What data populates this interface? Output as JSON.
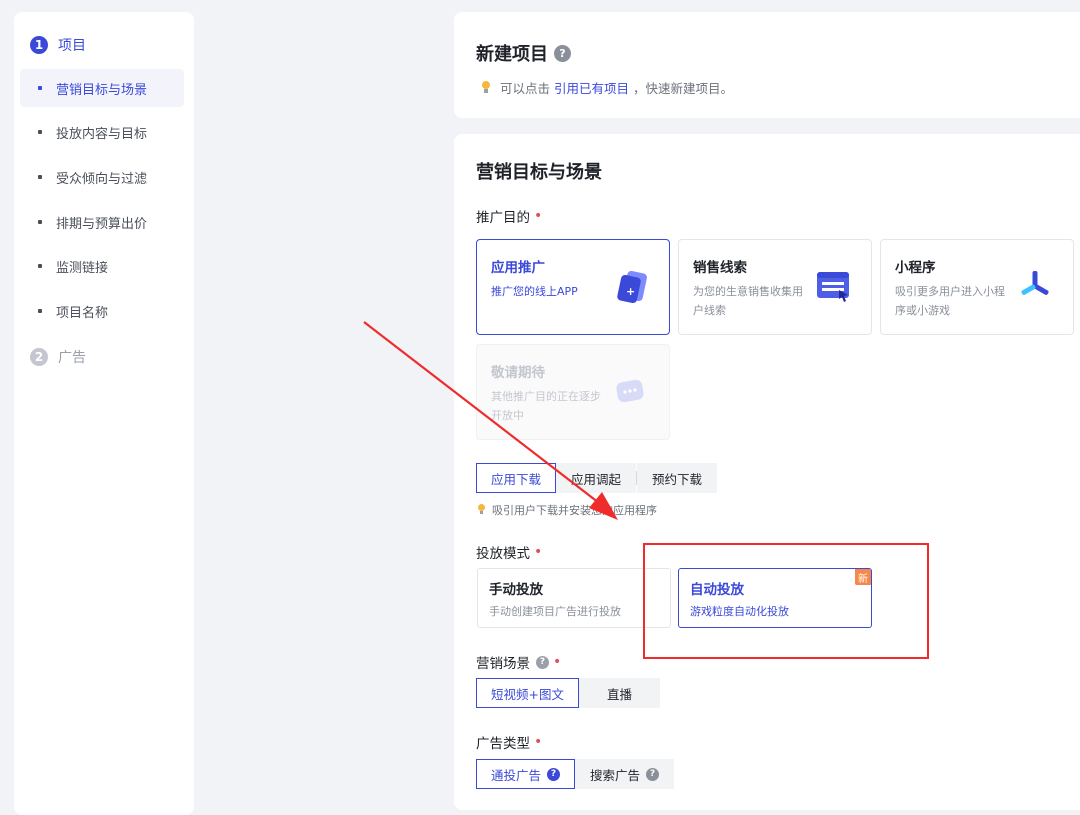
{
  "sidebar": {
    "steps": [
      {
        "num": "1",
        "label": "项目"
      },
      {
        "num": "2",
        "label": "广告"
      }
    ],
    "items": [
      {
        "label": "营销目标与场景"
      },
      {
        "label": "投放内容与目标"
      },
      {
        "label": "受众倾向与过滤"
      },
      {
        "label": "排期与预算出价"
      },
      {
        "label": "监测链接"
      },
      {
        "label": "项目名称"
      }
    ]
  },
  "header": {
    "title": "新建项目",
    "help_icon": "question-circle-icon",
    "hint_prefix": "可以点击",
    "hint_link": "引用已有项目",
    "hint_suffix": "，快速新建项目。"
  },
  "main": {
    "section_title": "营销目标与场景",
    "purpose": {
      "label": "推广目的",
      "required": "•",
      "cards": [
        {
          "title": "应用推广",
          "desc": "推广您的线上APP",
          "icon": "app-phone-icon"
        },
        {
          "title": "销售线索",
          "desc": "为您的生意销售收集用户线索",
          "icon": "form-window-icon"
        },
        {
          "title": "小程序",
          "desc": "吸引更多用户进入小程序或小游戏",
          "icon": "mini-program-icon"
        },
        {
          "title": "敬请期待",
          "desc": "其他推广目的正在逐步开放中",
          "icon": "chat-bubble-icon"
        }
      ]
    },
    "app_sub": {
      "options": [
        "应用下载",
        "应用调起",
        "预约下载"
      ],
      "hint": "吸引用户下载并安装您的应用程序"
    },
    "delivery_mode": {
      "label": "投放模式",
      "required": "•",
      "options": [
        {
          "title": "手动投放",
          "desc": "手动创建项目广告进行投放"
        },
        {
          "title": "自动投放",
          "desc": "游戏粒度自动化投放",
          "badge": "新"
        }
      ]
    },
    "scene": {
      "label": "营销场景",
      "required": "•",
      "options": [
        "短视频+图文",
        "直播"
      ]
    },
    "ad_type": {
      "label": "广告类型",
      "required": "•",
      "options": [
        "通投广告",
        "搜索广告"
      ]
    }
  },
  "colors": {
    "accent": "#3a49d8",
    "annotation": "#ef2b2b",
    "required": "#e34d59"
  }
}
